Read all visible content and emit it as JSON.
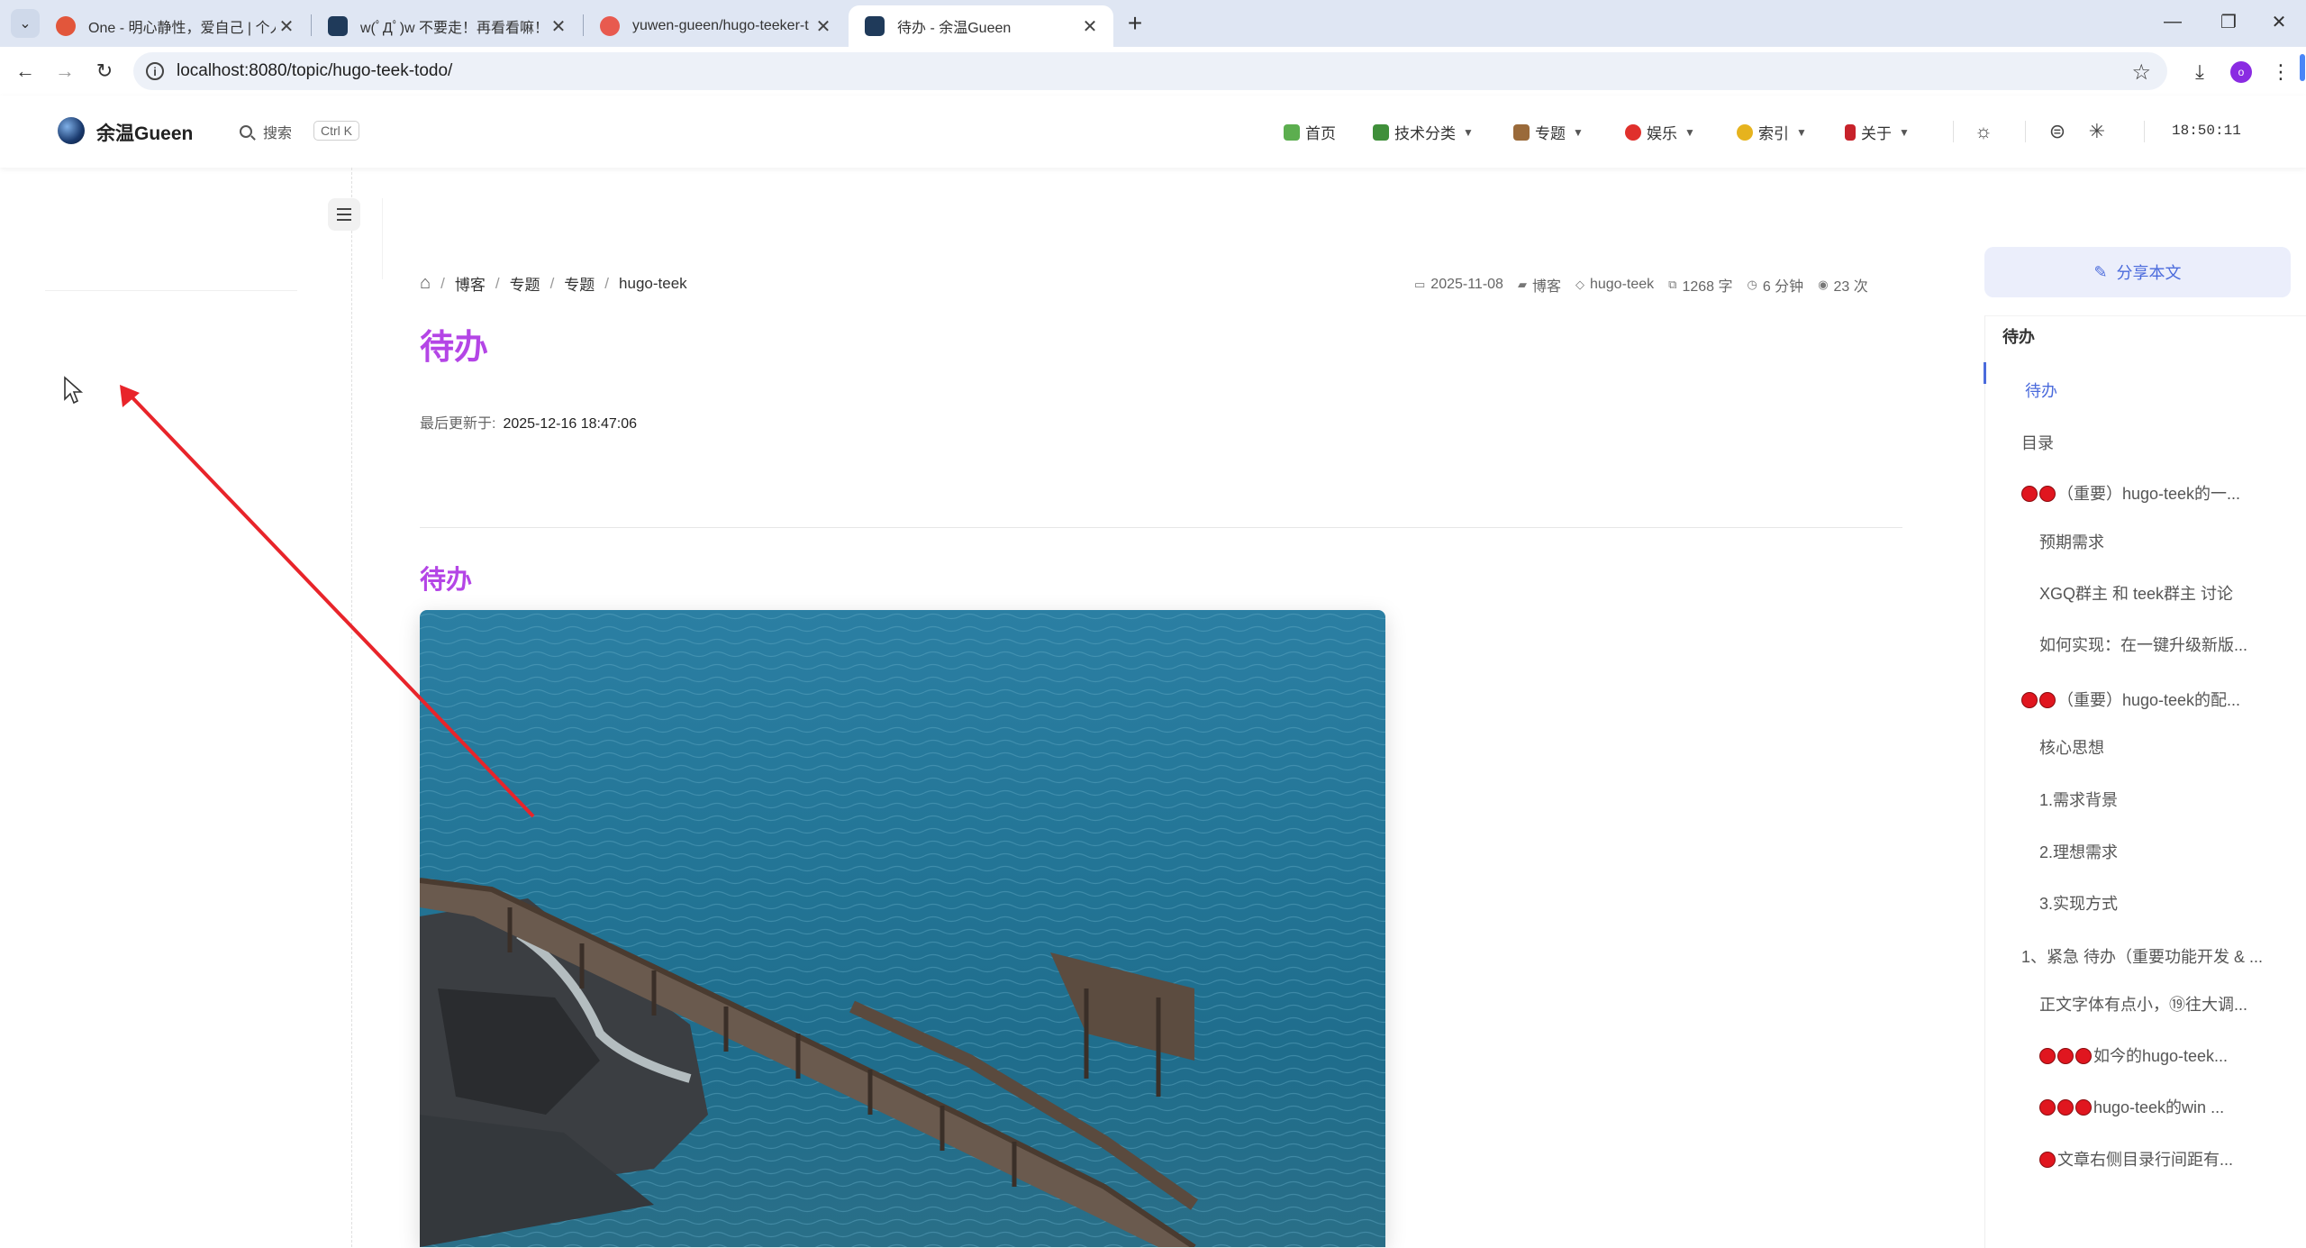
{
  "browser": {
    "tabs": [
      {
        "title": "One - 明心静性，爱自己 | 个人",
        "active": false
      },
      {
        "title": "w(ﾟДﾟ)w 不要走！再看看嘛！",
        "active": false
      },
      {
        "title": "yuwen-gueen/hugo-teeker-t",
        "active": false
      },
      {
        "title": "待办 - 余温Gueen",
        "active": true
      }
    ],
    "url": "localhost:8080/topic/hugo-teek-todo/",
    "profile_initial": "o"
  },
  "header": {
    "site_name": "余温Gueen",
    "search_label": "搜索",
    "search_shortcut": "Ctrl K",
    "nav": [
      {
        "label": "首页",
        "dropdown": false,
        "icon": "home-icon"
      },
      {
        "label": "技术分类",
        "dropdown": true,
        "icon": "book-icon"
      },
      {
        "label": "专题",
        "dropdown": true,
        "icon": "tools-icon"
      },
      {
        "label": "娱乐",
        "dropdown": true,
        "icon": "chat-icon"
      },
      {
        "label": "索引",
        "dropdown": true,
        "icon": "lemon-icon"
      },
      {
        "label": "关于",
        "dropdown": true,
        "icon": "traffic-light-icon"
      }
    ],
    "time": "18:50:11"
  },
  "article": {
    "breadcrumb": [
      "博客",
      "专题",
      "专题",
      "hugo-teek"
    ],
    "meta": {
      "date": "2025-11-08",
      "category": "博客",
      "tag": "hugo-teek",
      "words": "1268 字",
      "read_time": "6 分钟",
      "views": "23 次"
    },
    "title": "待办",
    "updated_label": "最后更新于:",
    "updated_value": "2025-12-16 18:47:06",
    "section_heading": "待办"
  },
  "toc": {
    "share_label": "分享本文",
    "title": "待办",
    "items": [
      {
        "label": "待办",
        "active": true,
        "dots": 0,
        "level": 1
      },
      {
        "label": "目录",
        "active": false,
        "dots": 0,
        "level": 1
      },
      {
        "label": "（重要）hugo-teek的一...",
        "active": false,
        "dots": 2,
        "level": 1
      },
      {
        "label": "预期需求",
        "active": false,
        "dots": 0,
        "level": 2
      },
      {
        "label": "XGQ群主 和 teek群主 讨论",
        "active": false,
        "dots": 0,
        "level": 2
      },
      {
        "label": "如何实现：在一键升级新版...",
        "active": false,
        "dots": 0,
        "level": 2
      },
      {
        "label": "（重要）hugo-teek的配...",
        "active": false,
        "dots": 2,
        "level": 1
      },
      {
        "label": "核心思想",
        "active": false,
        "dots": 0,
        "level": 2
      },
      {
        "label": "1.需求背景",
        "active": false,
        "dots": 0,
        "level": 2
      },
      {
        "label": "2.理想需求",
        "active": false,
        "dots": 0,
        "level": 2
      },
      {
        "label": "3.实现方式",
        "active": false,
        "dots": 0,
        "level": 2
      },
      {
        "label": "1、紧急 待办（重要功能开发 & ...",
        "active": false,
        "dots": 0,
        "level": 1
      },
      {
        "label": "正文字体有点小，⑲往大调...",
        "active": false,
        "dots": 0,
        "level": 2
      },
      {
        "label": "如今的hugo-teek...",
        "active": false,
        "dots": 3,
        "level": 2
      },
      {
        "label": "hugo-teek的win ...",
        "active": false,
        "dots": 3,
        "level": 2
      },
      {
        "label": "文章右侧目录行间距有...",
        "active": false,
        "dots": 1,
        "level": 2
      }
    ]
  },
  "colors": {
    "accent_purple": "#b445e6",
    "toc_active": "#4b6bdc",
    "arrow_red": "#e8242a"
  }
}
